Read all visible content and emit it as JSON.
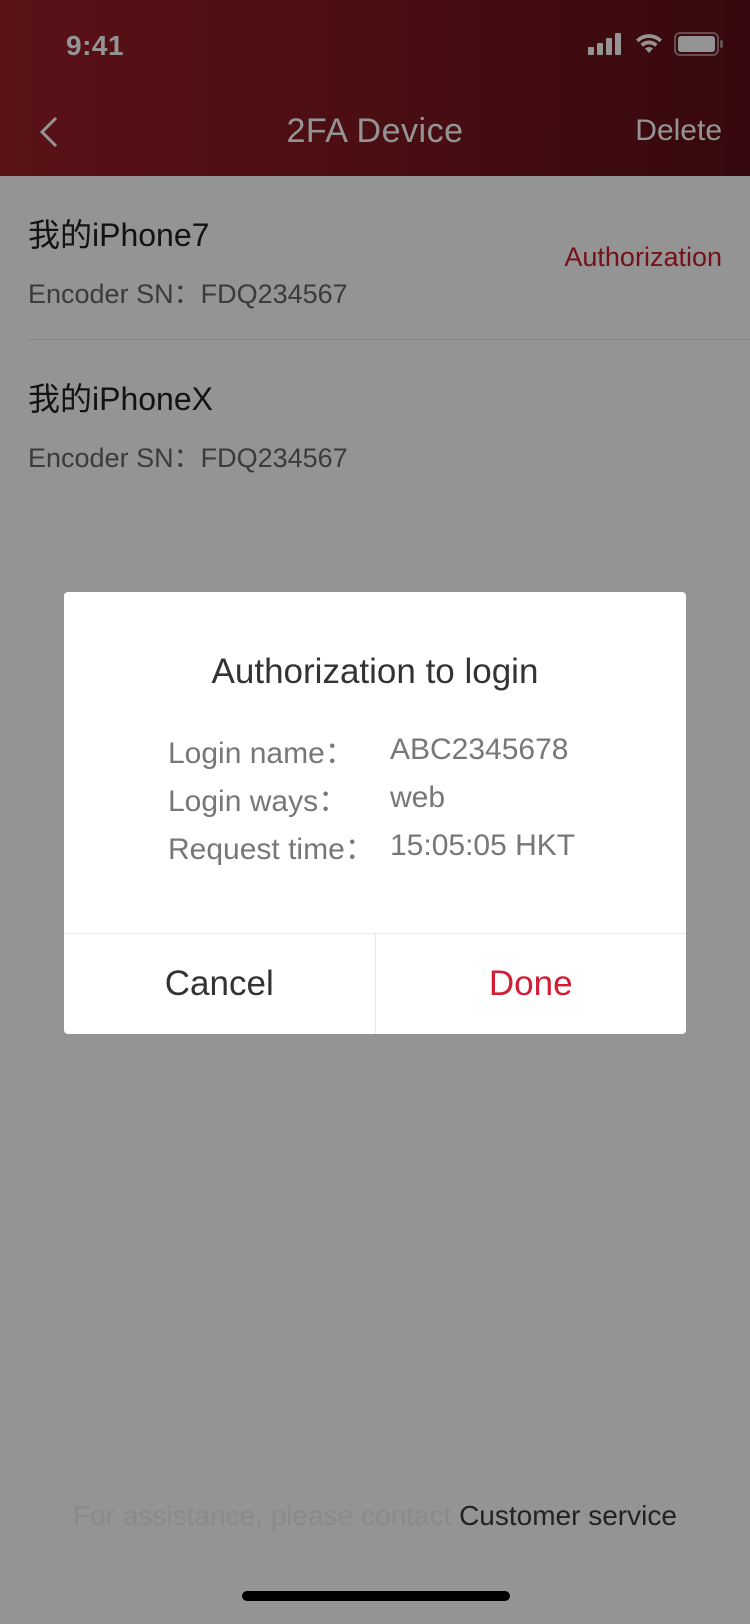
{
  "status_bar": {
    "time": "9:41"
  },
  "nav": {
    "title": "2FA Device",
    "delete_label": "Delete"
  },
  "devices": [
    {
      "name": "我的iPhone7",
      "sn_label": "Encoder SN：",
      "sn": "FDQ234567",
      "action": "Authorization"
    },
    {
      "name": "我的iPhoneX",
      "sn_label": "Encoder SN：",
      "sn": "FDQ234567"
    }
  ],
  "dialog": {
    "title": "Authorization to login",
    "rows": [
      {
        "label": "Login name：",
        "value": "ABC2345678"
      },
      {
        "label": "Login ways：",
        "value": "web"
      },
      {
        "label": "Request time：",
        "value": "15:05:05 HKT"
      }
    ],
    "cancel_label": "Cancel",
    "done_label": "Done"
  },
  "footer": {
    "text": "For assistance, please contact ",
    "link": "Customer service"
  },
  "colors": {
    "header_start": "#9b1f27",
    "header_end": "#5e0f17",
    "accent": "#d21d35"
  }
}
